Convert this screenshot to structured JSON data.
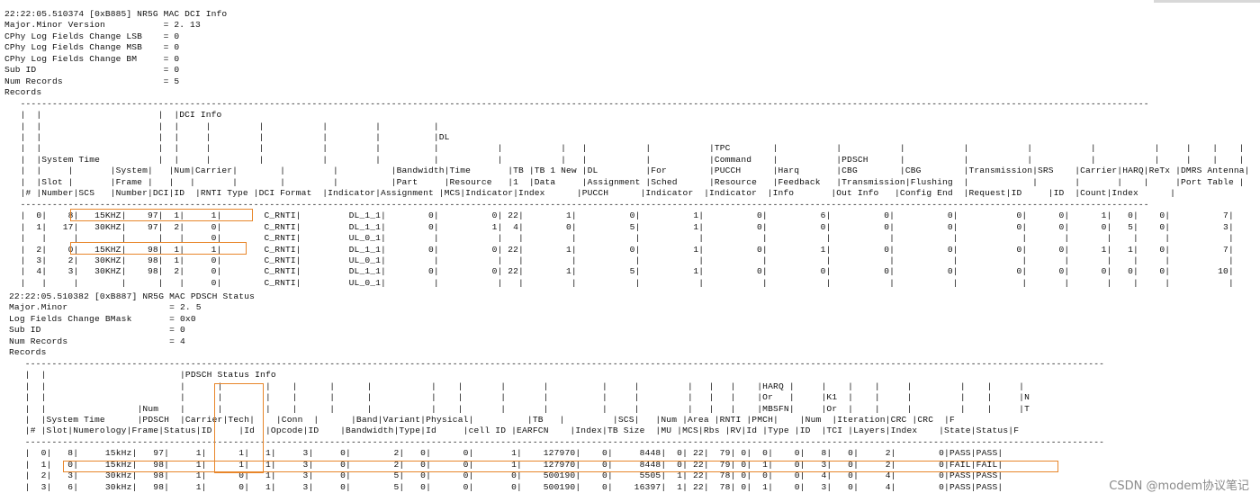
{
  "dci_log": {
    "lines": [
      "22:22:05.510374 [0xB885] NR5G MAC DCI Info",
      "Major.Minor Version           = 2. 13",
      "CPhy Log Fields Change LSB    = 0",
      "CPhy Log Fields Change MSB    = 0",
      "CPhy Log Fields Change BM     = 0",
      "Sub ID                        = 0",
      "Num Records                   = 5",
      "Records",
      "   ---------------------------------------------------------------------------------------------------------------------------------------------------------------------------------------------------------------------",
      "   |  |                      |  |DCI Info",
      "   |  |                      |  |     |         |           |         |          |",
      "   |  |                      |  |     |         |           |         |          |DL",
      "   |  |                      |  |     |         |           |         |          |           |           |   |           |           |TPC        |           |           |           |           |           |           |     |    |    |",
      "   |  |System Time           |  |     |         |           |         |          |           |           |   |           |           |Command    |           |PDSCH      |           |           |           |           |     |    |    |",
      "   |  |     |       |System|   |Num|Carrier|        |         |          |Bandwidth|Time       |TB |TB 1 New |DL         |For        |PUCCH      |Harq       |CBG        |CBG        |Transmission|SRS    |Carrier|HARQ|ReTx |DMRS Antenna|",
      "   |  |Slot |       |Frame |   |   |       |        |         |          |Part     |Resource   |1  |Data     |Assignment |Sched      |Resource   |Feedback   |Transmission|Flushing  |            |       |       |    |     |Port Table |",
      "   |# |Number|SCS   |Number|DCI|ID  |RNTI Type |DCI Format  |Indicator|Assignment |MCS|Indicator|Index      |PUCCH      |Indicator  |Indicator  |Info       |Out Info   |Config End  |Request|ID     |ID  |Count|Index      |",
      "   ---------------------------------------------------------------------------------------------------------------------------------------------------------------------------------------------------------------------",
      "   |  0|    8|   15KHZ|    97|  1|     1|        C_RNTI|         DL_1_1|        0|          0| 22|        1|          0|          1|          0|          6|          0|          0|           0|      0|      1|   0|    0|          7|",
      "   |  1|   17|   30KHZ|    97|  2|     0|        C_RNTI|         DL_1_1|        0|          1|  4|        0|          5|          1|          0|          0|          0|          0|           0|      0|      0|   5|    0|          3|",
      "   |   |     |        |      |   |     0|        C_RNTI|         UL_0_1|         |           |   |         |           |           |           |           |           |           |            |       |       |    |     |           |",
      "   |  2|    0|   15KHZ|    98|  1|     1|        C_RNTI|         DL_1_1|        0|          0| 22|        1|          0|          1|          0|          1|          0|          0|           0|      0|      1|   1|    0|          7|",
      "   |  3|    2|   30KHZ|    98|  1|     0|        C_RNTI|         UL_0_1|         |           |   |         |           |           |           |           |           |           |            |       |       |    |     |           |",
      "   |  4|    3|   30KHZ|    98|  2|     0|        C_RNTI|         DL_1_1|        0|          0| 22|        1|          5|          1|          0|          0|          0|          0|           0|      0|      0|   0|    0|         10|",
      "   |   |     |        |      |   |     0|        C_RNTI|         UL_0_1|         |           |   |         |           |           |           |           |           |           |            |       |       |    |     |           |"
    ]
  },
  "pdsch_log": {
    "lines": [
      "22:22:05.510382 [0xB887] NR5G MAC PDSCH Status",
      "Major.Minor                   = 2. 5",
      "Log Fields Change BMask       = 0x0",
      "Sub ID                        = 0",
      "Num Records                   = 4",
      "Records",
      "   ----------------------------------------------------------------------------------------------------------------------------------------------------------------------------------------------------------",
      "   |  |                         |PDSCH Status Info",
      "   |  |                         |      |        |    |      |      |           |    |       |       |          |     |         |   |   |    |HARQ |     |    |    |     |         |    |     |",
      "   |  |                         |      |        |    |      |      |           |    |       |       |          |     |         |   |   |    |Or   |     |K1  |    |     |         |    |     |N",
      "   |  |                 |Num    |      |        |    |      |      |           |    |       |       |          |     |         |   |   |    |MBSFN|     |Or  |    |     |         |    |     |T",
      "   |  |System Time      |PDSCH  |Carrier|Tech|    |Conn  |      |Band|Variant|Physical|          |TB   |         |SCS|   |Num |Area |RNTI |PMCH|    |Num  |Iteration|CRC |CRC  |F",
      "   |# |Slot|Numerology|Frame|Status|ID     |Id  |Opcode|ID    |Bandwidth|Type|Id     |cell ID |EARFCN    |Index|TB Size  |MU |MCS|Rbs |RV|Id |Type |ID  |TCI |Layers|Index    |State|Status|F",
      "   ----------------------------------------------------------------------------------------------------------------------------------------------------------------------------------------------------------",
      "   |  0|   8|     15kHz|   97|     1|      1|   1|     3|     0|        2|   0|      0|       1|    127970|    0|     8448|  0| 22|  79| 0|  0|    0|   8|   0|     2|        0|PASS|PASS|",
      "   |  1|   0|     15kHz|   98|     1|      1|   1|     3|     0|        2|   0|      0|       1|    127970|    0|     8448|  0| 22|  79| 0|  1|    0|   3|   0|     2|        0|FAIL|FAIL|",
      "   |  2|   3|     30kHz|   98|     1|      0|   1|     3|     0|        5|   0|      0|       0|    500190|    0|     5505|  1| 22|  78| 0|  0|    0|   4|   0|     4|        0|PASS|PASS|",
      "   |  3|   6|     30kHz|   98|     1|      0|   1|     3|     0|        5|   0|      0|       0|    500190|    0|    16397|  1| 22|  78| 0|  1|    0|   3|   0|     4|        0|PASS|PASS|"
    ]
  },
  "watermark": "CSDN @modem协议笔记",
  "accent_color": "#e8862a"
}
